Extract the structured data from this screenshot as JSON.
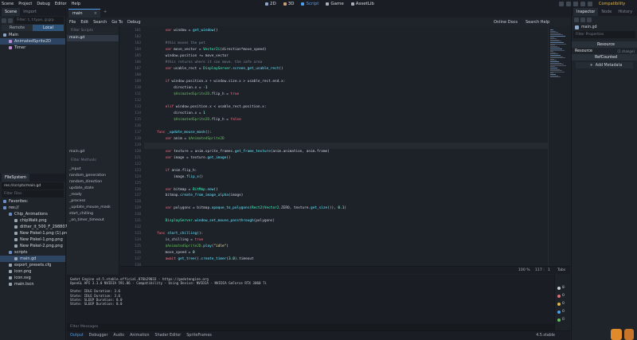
{
  "menu": [
    "Scene",
    "Project",
    "Debug",
    "Editor",
    "Help"
  ],
  "workspaces": [
    "2D",
    "3D",
    "Script",
    "Game",
    "AssetLib"
  ],
  "active_workspace": "Script",
  "renderer": "Compatibility",
  "scene_dock": {
    "tabs": [
      "Scene",
      "Import"
    ],
    "filter_placeholder": "Filter: t, t:type, g:grp",
    "remote": "Remote",
    "local": "Local",
    "tree": [
      {
        "label": "Main",
        "depth": 0,
        "icon": "node2d-icon"
      },
      {
        "label": "AnimatedSprite2D",
        "depth": 1,
        "icon": "sprite-icon",
        "selected": true
      },
      {
        "label": "Timer",
        "depth": 1,
        "icon": "timer-icon"
      }
    ]
  },
  "filesystem": {
    "title": "FileSystem",
    "path": "res://scripts/main.gd",
    "filter_placeholder": "Filter Files",
    "items": [
      {
        "label": "Favorites:",
        "depth": 0
      },
      {
        "label": "res://",
        "depth": 0
      },
      {
        "label": "Chip_Animations",
        "depth": 1
      },
      {
        "label": "chipWalk.png",
        "depth": 2
      },
      {
        "label": "dither_it_500_F_298807133...",
        "depth": 2
      },
      {
        "label": "New Piskel-1.png (1).png",
        "depth": 2
      },
      {
        "label": "New Piskel-1.png.png",
        "depth": 2
      },
      {
        "label": "New Piskel-2.png.png",
        "depth": 2
      },
      {
        "label": "scripts",
        "depth": 1
      },
      {
        "label": "main.gd",
        "depth": 2,
        "selected": true
      },
      {
        "label": "export_presets.cfg",
        "depth": 1
      },
      {
        "label": "icon.png",
        "depth": 1
      },
      {
        "label": "icon.svg",
        "depth": 1
      },
      {
        "label": "main.tscn",
        "depth": 1
      }
    ]
  },
  "editor": {
    "tab": "main",
    "script_menu": [
      "File",
      "Edit",
      "Search",
      "Go To",
      "Debug"
    ],
    "online_docs": "Online Docs",
    "search_help": "Search Help",
    "filter_scripts": "Filter Scripts",
    "scripts": [
      "main.gd"
    ],
    "current_script": "main.gd",
    "filter_methods": "Filter Methods",
    "methods": [
      "_input",
      "random_generation",
      "random_direction",
      "update_state",
      "_ready",
      "_process",
      "_update_mouse_mask",
      "start_chilling",
      "_on_timer_timeout"
    ],
    "lines": [
      {
        "n": "101",
        "t": "    var window = get_window()"
      },
      {
        "n": "102",
        "t": ""
      },
      {
        "n": "103",
        "t": "    #this moves the pet"
      },
      {
        "n": "104",
        "t": "    var move_vector = Vector2i(direction*move_speed)"
      },
      {
        "n": "105",
        "t": "    window.position += move_vector"
      },
      {
        "n": "106",
        "t": "    #this returns where it can move. the safe area"
      },
      {
        "n": "107",
        "t": "    var usable_rect = DisplayServer.screen_get_usable_rect()"
      },
      {
        "n": "108",
        "t": ""
      },
      {
        "n": "109",
        "t": "    if window.position.x + window.size.x > usable_rect.end.x:"
      },
      {
        "n": "110",
        "t": "        direction.x = -1"
      },
      {
        "n": "111",
        "t": "        $AnimatedSprite2D.flip_h = true"
      },
      {
        "n": "112",
        "t": ""
      },
      {
        "n": "113",
        "t": "    elif window.position.x < usable_rect.position.x:"
      },
      {
        "n": "114",
        "t": "        direction.x = 1"
      },
      {
        "n": "115",
        "t": "        $AnimatedSprite2D.flip_h = false"
      },
      {
        "n": "116",
        "t": ""
      },
      {
        "n": "117",
        "t": "func _update_mouse_mask():"
      },
      {
        "n": "118",
        "t": "    var anim = $AnimatedSprite2D"
      },
      {
        "n": "119",
        "t": ""
      },
      {
        "n": "120",
        "t": "    var texture = anim.sprite_frames.get_frame_texture(anim.animation, anim.frame)"
      },
      {
        "n": "121",
        "t": "    var image = texture.get_image()"
      },
      {
        "n": "122",
        "t": ""
      },
      {
        "n": "123",
        "t": "    if anim.flip_h:"
      },
      {
        "n": "124",
        "t": "        image.flip_x()"
      },
      {
        "n": "125",
        "t": ""
      },
      {
        "n": "126",
        "t": "    var bitmap = BitMap.new()"
      },
      {
        "n": "127",
        "t": "    bitmap.create_from_image_alpha(image)"
      },
      {
        "n": "128",
        "t": ""
      },
      {
        "n": "129",
        "t": "    var polygons = bitmap.opaque_to_polygons(Rect2(Vector2.ZERO, texture.get_size()), 0.1)"
      },
      {
        "n": "130",
        "t": ""
      },
      {
        "n": "131",
        "t": "    DisplayServer.window_set_mouse_passthrough(polygons)"
      },
      {
        "n": "132",
        "t": ""
      },
      {
        "n": "133",
        "t": "func start_chilling():"
      },
      {
        "n": "134",
        "t": "    is_chilling = true"
      },
      {
        "n": "135",
        "t": "    $AnimatedSprite2D.play(\"idle\")"
      },
      {
        "n": "136",
        "t": "    move_speed = 0"
      },
      {
        "n": "137",
        "t": "    await get_tree().create_timer(3.0).timeout"
      },
      {
        "n": "138",
        "t": ""
      }
    ],
    "zoom": "100 %",
    "line_col": "117 :",
    "col": "1",
    "indent": "Tabs"
  },
  "output": {
    "lines": [
      "Godot Engine v4.5.stable.official.876b29033 - https://godotengine.org",
      "OpenGL API 3.3.0 NVIDIA 591.86 - Compatibility - Using Device: NVIDIA - NVIDIA GeForce RTX 3060 Ti",
      "",
      "State: IDLE Duration: 3.6",
      "State: IDLE Duration: 3.6",
      "State: SLEEP Duration: 8.0",
      "State: SLEEP Duration: 8.0"
    ],
    "filter_placeholder": "Filter Messages",
    "counts": [
      "8",
      "0",
      "0",
      "0",
      "0"
    ]
  },
  "bottom_tabs": [
    "Output",
    "Debugger",
    "Audio",
    "Animation",
    "Shader Editor",
    "SpriteFrames"
  ],
  "active_bottom_tab": "Output",
  "version": "4.5.stable",
  "inspector": {
    "tabs": [
      "Inspector",
      "Node",
      "History"
    ],
    "object": "main.gd",
    "filter_placeholder": "Filter Properties",
    "resource_header": "Resource",
    "resource_row": "Resource",
    "resource_value": "(1 change)",
    "refcounted": "RefCounted",
    "add_metadata": "Add Metadata"
  },
  "colors": {
    "accent": "#4f9ef0",
    "renderer": "#e0b54a"
  }
}
